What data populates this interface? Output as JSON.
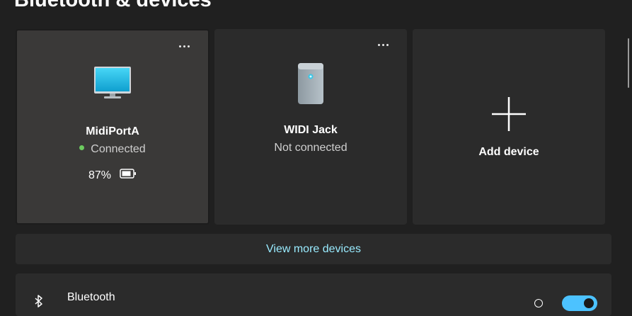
{
  "page": {
    "title": "Bluetooth & devices"
  },
  "devices": [
    {
      "name": "MidiPortA",
      "status": "Connected",
      "status_color": "#6ccb5f",
      "battery": "87%",
      "icon": "monitor-icon"
    },
    {
      "name": "WIDI Jack",
      "status": "Not connected",
      "icon": "pc-tower-icon"
    }
  ],
  "add_device": {
    "label": "Add device",
    "icon": "plus-icon"
  },
  "view_more": {
    "label": "View more devices",
    "color": "#99ebff"
  },
  "bluetooth": {
    "label": "Bluetooth",
    "icon": "bluetooth-icon",
    "toggle_on": true,
    "accent": "#4cc2ff"
  }
}
